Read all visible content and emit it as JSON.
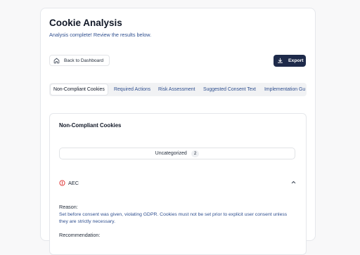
{
  "page": {
    "title": "Cookie Analysis",
    "subtitle": "Analysis complete! Review the results below."
  },
  "toolbar": {
    "back_label": "Back to Dashboard",
    "back_icon": "home-icon",
    "export_label": "Export",
    "export_icon": "download-icon"
  },
  "tabs": [
    {
      "label": "Non-Compliant Cookies",
      "active": true
    },
    {
      "label": "Required Actions",
      "active": false
    },
    {
      "label": "Risk Assessment",
      "active": false
    },
    {
      "label": "Suggested Consent Text",
      "active": false
    },
    {
      "label": "Implementation Gu",
      "active": false
    }
  ],
  "section": {
    "title": "Non-Compliant Cookies",
    "category": {
      "label": "Uncategorized",
      "count": "2"
    },
    "cookie": {
      "name": "AEC",
      "status_icon": "alert-circle-icon",
      "toggle_icon": "chevron-up-icon",
      "reason_label": "Reason:",
      "reason_text": "Set before consent was given, violating GDPR. Cookies must not be set prior to explicit user consent unless they are strictly necessary.",
      "recommendation_label": "Recommendation:"
    }
  },
  "colors": {
    "primary": "#1e2a4a",
    "link_text": "#2f4f8f",
    "alert": "#dc2626"
  }
}
